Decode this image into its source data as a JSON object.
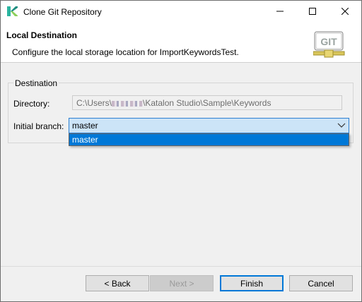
{
  "window": {
    "title": "Clone Git Repository",
    "controls": {
      "minimize": "minimize-icon",
      "maximize": "maximize-icon",
      "close": "close-icon"
    }
  },
  "header": {
    "title": "Local Destination",
    "description": "Configure the local storage location for ImportKeywordsTest.",
    "logo_text": "GIT"
  },
  "destination": {
    "group_label": "Destination",
    "directory_label": "Directory:",
    "directory_prefix": "C:\\Users\\",
    "directory_suffix": "\\Katalon Studio\\Sample\\Keywords",
    "branch_label": "Initial branch:",
    "branch_value": "master",
    "branch_options": [
      "master"
    ]
  },
  "buttons": {
    "back": "< Back",
    "next": "Next >",
    "finish": "Finish",
    "cancel": "Cancel"
  },
  "colors": {
    "accent": "#0078d7",
    "selected_combo_bg": "#cce4f7",
    "brand_katalon": "#1fa3a0"
  }
}
